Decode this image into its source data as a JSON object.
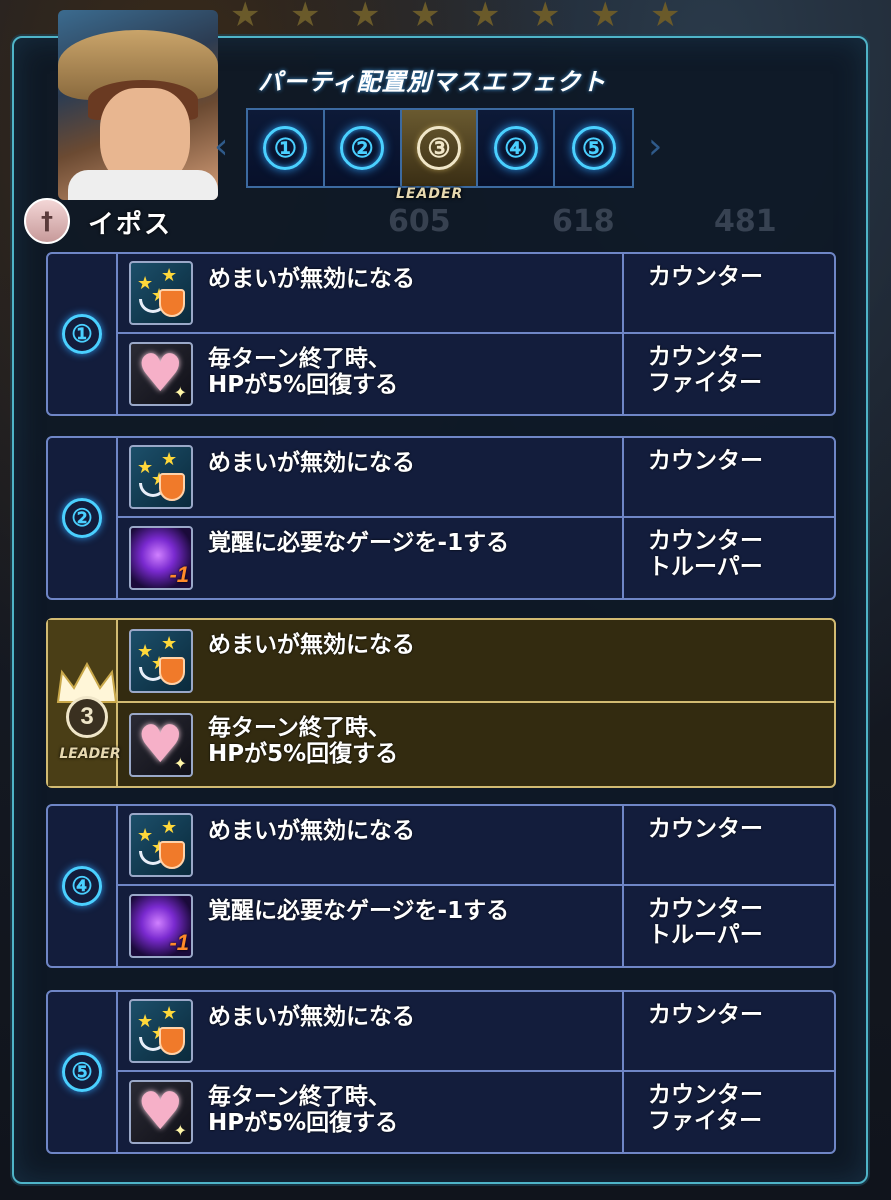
{
  "screen": {
    "title": "パーティ配置別マスエフェクト",
    "character_name": "イポス",
    "class_icon": "sword-icon",
    "colors": {
      "panel_border": "#4fb4c8",
      "row_border": "#6f86c6",
      "leader_border": "#d2bb72",
      "number_glow": "#4ad0ff"
    }
  },
  "tabs": {
    "items": [
      {
        "label": "①",
        "active": false
      },
      {
        "label": "②",
        "active": false
      },
      {
        "label": "③",
        "active": true
      },
      {
        "label": "④",
        "active": false
      },
      {
        "label": "⑤",
        "active": false
      }
    ],
    "leader_label": "LEADER"
  },
  "background_stats": [
    "605",
    "618",
    "481"
  ],
  "groups": [
    {
      "number": "①",
      "leader": false,
      "rows": [
        {
          "icon": "dizzy-shield-icon",
          "effect_lines": [
            "めまいが無効になる"
          ],
          "class_lines": [
            "カウンター"
          ]
        },
        {
          "icon": "heart-heal-icon",
          "effect_lines": [
            "毎ターン終了時、",
            "HPが5%回復する"
          ],
          "class_lines": [
            "カウンター",
            "ファイター"
          ]
        }
      ]
    },
    {
      "number": "②",
      "leader": false,
      "rows": [
        {
          "icon": "dizzy-shield-icon",
          "effect_lines": [
            "めまいが無効になる"
          ],
          "class_lines": [
            "カウンター"
          ]
        },
        {
          "icon": "gauge-minus-icon",
          "effect_lines": [
            "覚醒に必要なゲージを-1する"
          ],
          "class_lines": [
            "カウンター",
            "トルーパー"
          ]
        }
      ]
    },
    {
      "number": "3",
      "leader": true,
      "leader_label": "LEADER",
      "rows": [
        {
          "icon": "dizzy-shield-icon",
          "effect_lines": [
            "めまいが無効になる"
          ],
          "class_lines": []
        },
        {
          "icon": "heart-heal-icon",
          "effect_lines": [
            "毎ターン終了時、",
            "HPが5%回復する"
          ],
          "class_lines": []
        }
      ]
    },
    {
      "number": "④",
      "leader": false,
      "rows": [
        {
          "icon": "dizzy-shield-icon",
          "effect_lines": [
            "めまいが無効になる"
          ],
          "class_lines": [
            "カウンター"
          ]
        },
        {
          "icon": "gauge-minus-icon",
          "effect_lines": [
            "覚醒に必要なゲージを-1する"
          ],
          "class_lines": [
            "カウンター",
            "トルーパー"
          ]
        }
      ]
    },
    {
      "number": "⑤",
      "leader": false,
      "rows": [
        {
          "icon": "dizzy-shield-icon",
          "effect_lines": [
            "めまいが無効になる"
          ],
          "class_lines": [
            "カウンター"
          ]
        },
        {
          "icon": "heart-heal-icon",
          "effect_lines": [
            "毎ターン終了時、",
            "HPが5%回復する"
          ],
          "class_lines": [
            "カウンター",
            "ファイター"
          ]
        }
      ]
    }
  ]
}
